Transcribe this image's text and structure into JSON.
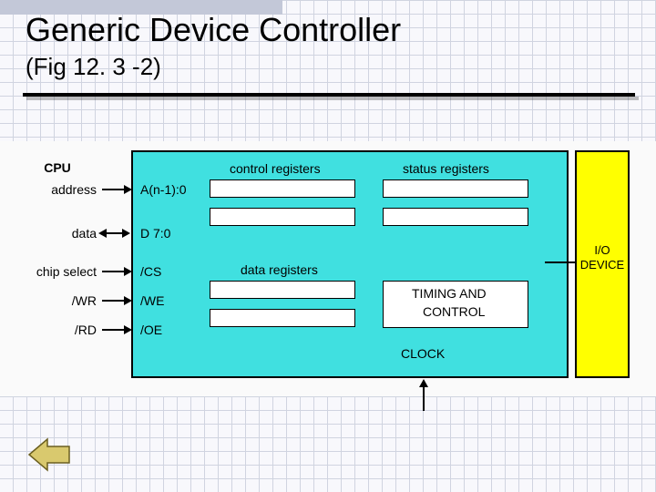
{
  "title": "Generic Device Controller",
  "subtitle": "(Fig 12. 3 -2)",
  "cpu": {
    "header": "CPU",
    "rows": [
      "address",
      "data",
      "chip select",
      "/WR",
      "/RD"
    ]
  },
  "controller_signals": [
    "A(n-1):0",
    "D 7:0",
    "/CS",
    "/WE",
    "/OE"
  ],
  "blocks": {
    "control_registers": "control registers",
    "status_registers": "status registers",
    "data_registers": "data registers",
    "timing_control_l1": "TIMING AND",
    "timing_control_l2": "CONTROL",
    "clock": "CLOCK"
  },
  "io_device_l1": "I/O",
  "io_device_l2": "DEVICE",
  "icons": {
    "back": "back-arrow-icon"
  }
}
